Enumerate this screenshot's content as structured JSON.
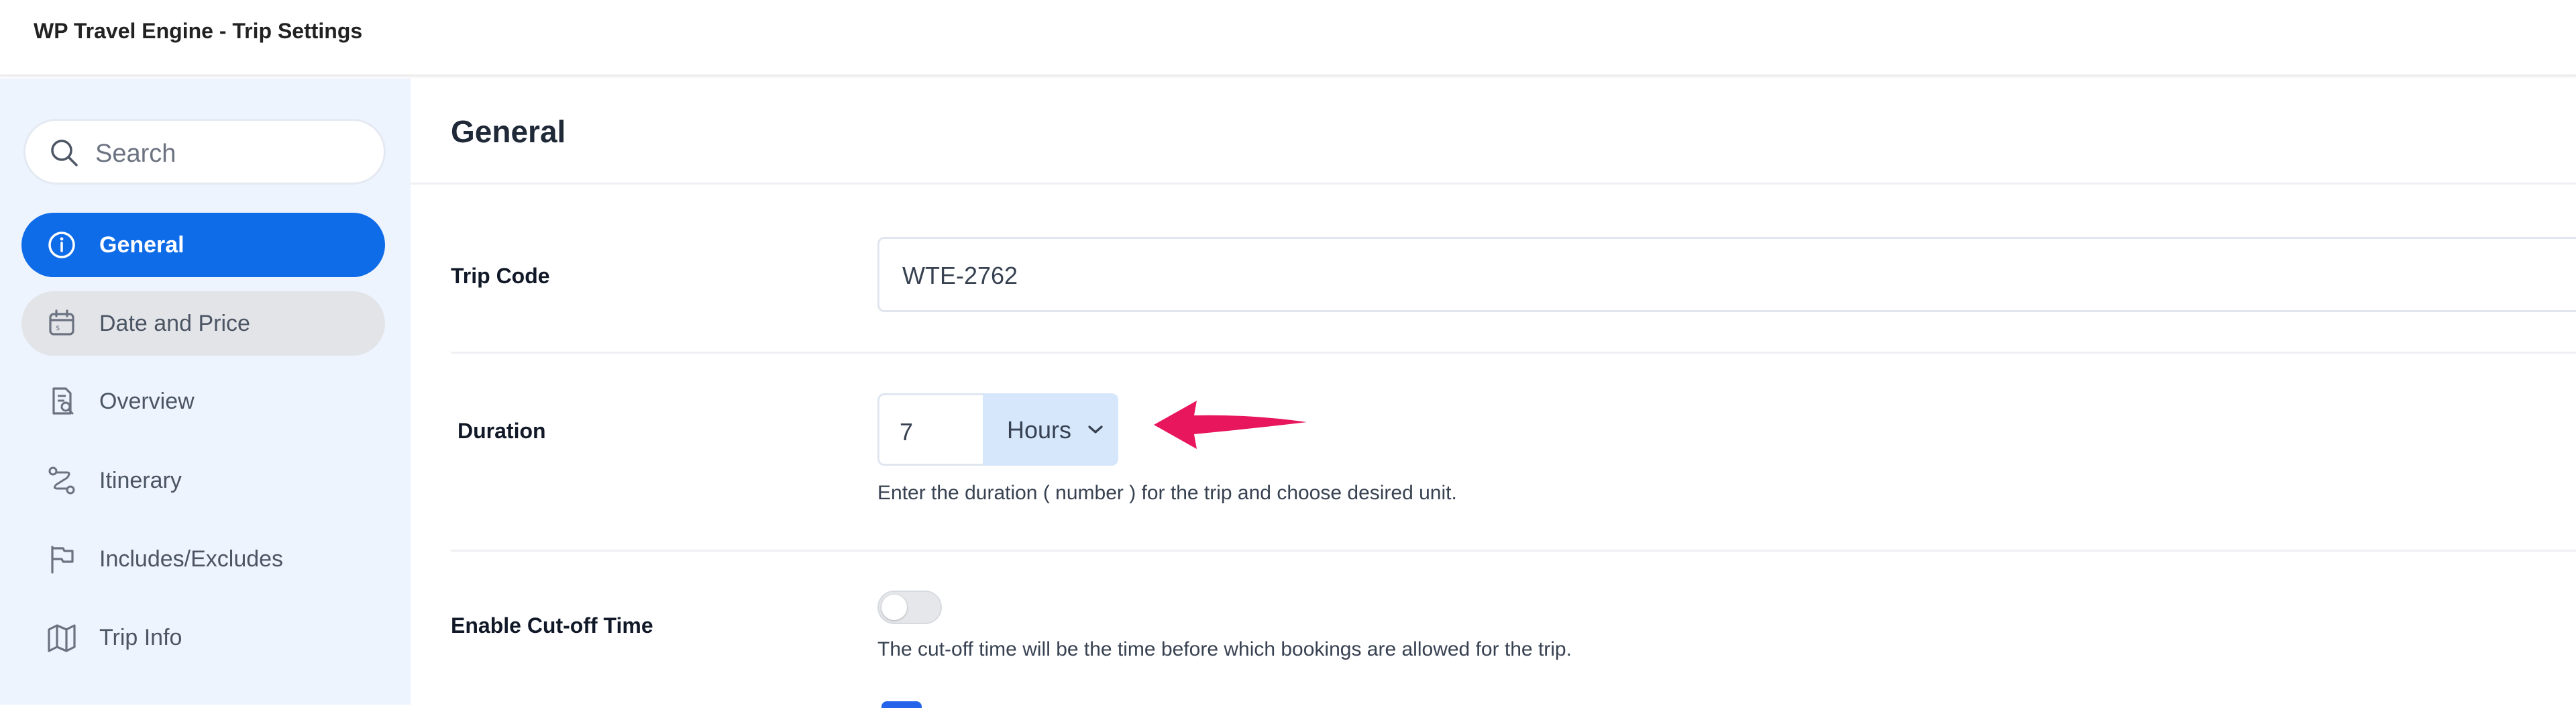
{
  "window": {
    "title": "WP Travel Engine - Trip Settings"
  },
  "sidebar": {
    "search": {
      "placeholder": "Search",
      "icon": "search-icon"
    },
    "items": [
      {
        "label": "General",
        "icon": "info-circle-icon",
        "state": "active"
      },
      {
        "label": "Date and Price",
        "icon": "calendar-icon",
        "state": "hover"
      },
      {
        "label": "Overview",
        "icon": "document-search-icon",
        "state": "normal"
      },
      {
        "label": "Itinerary",
        "icon": "route-icon",
        "state": "normal"
      },
      {
        "label": "Includes/Excludes",
        "icon": "flag-icon",
        "state": "normal"
      },
      {
        "label": "Trip Info",
        "icon": "map-icon",
        "state": "normal"
      }
    ]
  },
  "main": {
    "section_title": "General",
    "fields": {
      "trip_code": {
        "label": "Trip Code",
        "value": "WTE-2762"
      },
      "duration": {
        "label": "Duration",
        "value": "7",
        "unit": "Hours",
        "help": "Enter the duration ( number ) for the trip and choose desired unit."
      },
      "cutoff": {
        "label": "Enable Cut-off Time",
        "enabled": false,
        "help": "The cut-off time will be the time before which bookings are allowed for the trip."
      }
    }
  },
  "colors": {
    "accent": "#0f6ce8",
    "sidebar_bg": "#eef4fe",
    "unit_bg": "#d6e6fb",
    "annotation_arrow": "#e8175d"
  }
}
